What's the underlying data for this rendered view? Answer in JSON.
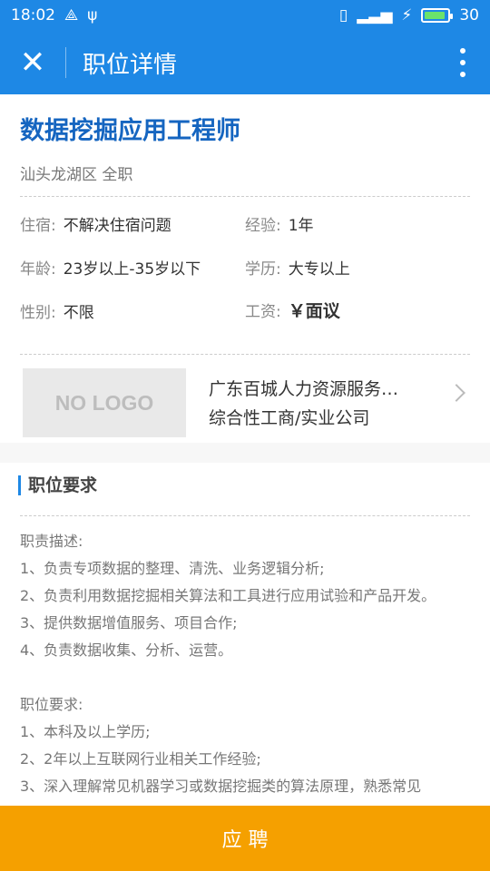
{
  "status": {
    "time": "18:02",
    "battery": "30"
  },
  "appbar": {
    "title": "职位详情"
  },
  "job": {
    "title": "数据挖掘应用工程师",
    "location": "汕头龙湖区 全职",
    "fields": [
      {
        "key": "住宿:",
        "value": "不解决住宿问题"
      },
      {
        "key": "经验:",
        "value": "1年"
      },
      {
        "key": "年龄:",
        "value": "23岁以上-35岁以下"
      },
      {
        "key": "学历:",
        "value": "大专以上"
      },
      {
        "key": "性别:",
        "value": "不限"
      },
      {
        "key": "工资:",
        "value": "￥面议"
      }
    ]
  },
  "company": {
    "logo_text": "NO LOGO",
    "name": "广东百城人力资源服务…",
    "type": "综合性工商/实业公司"
  },
  "requirements": {
    "title": "职位要求",
    "text": "职责描述:\n1、负责专项数据的整理、清洗、业务逻辑分析;\n2、负责利用数据挖掘相关算法和工具进行应用试验和产品开发。\n3、提供数据增值服务、项目合作;\n4、负责数据收集、分析、运营。\n\n职位要求:\n1、本科及以上学历;\n2、2年以上互联网行业相关工作经验;\n3、深入理解常见机器学习或数据挖掘类的算法原理，熟悉常见"
  },
  "bottom": {
    "apply_label": "应 聘"
  }
}
